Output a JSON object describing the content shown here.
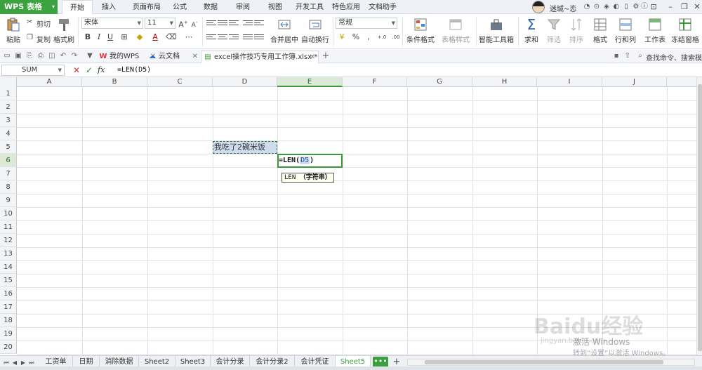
{
  "app": {
    "logo": "WPS 表格",
    "logo_arrow": "▾"
  },
  "menu_tabs": [
    {
      "label": "开始",
      "active": true
    },
    {
      "label": "插入"
    },
    {
      "label": "页面布局"
    },
    {
      "label": "公式"
    },
    {
      "label": "数据"
    },
    {
      "label": "审阅"
    },
    {
      "label": "视图"
    },
    {
      "label": "开发工具"
    },
    {
      "label": "特色应用"
    },
    {
      "label": "文档助手"
    }
  ],
  "user": {
    "name": "迷城~恋"
  },
  "ribbon": {
    "paste": "粘贴",
    "cut": "剪切",
    "copy": "复制",
    "format_painter": "格式刷",
    "font_name": "宋体",
    "font_size": "11",
    "bold": "B",
    "italic": "I",
    "underline": "U",
    "merge_center": "合并居中",
    "wrap_text": "自动换行",
    "number_format": "常规",
    "percent": "%",
    "thousands": ",",
    "decimal_plus": "+.0",
    "decimal_minus": ".00",
    "conditional_format": "条件格式",
    "table_style": "表格样式",
    "smart_toolbox": "智能工具箱",
    "sum": "求和",
    "filter": "筛选",
    "sort": "排序",
    "format": "格式",
    "rows_cols": "行和列",
    "worksheet": "工作表",
    "freeze": "冻结窗格"
  },
  "doc_tabs": [
    {
      "label": "我的WPS",
      "icon": "W"
    },
    {
      "label": "云文档",
      "icon": "☁"
    },
    {
      "label": "excel操作技巧专用工作簿.xlsx *",
      "icon": "▤",
      "active": true
    }
  ],
  "search_placeholder": "查找命令、搜索模板",
  "formula_bar": {
    "name_box": "SUM",
    "cancel": "✕",
    "confirm": "✓",
    "fx": "fx",
    "formula": "=LEN(D5)"
  },
  "columns": [
    "A",
    "B",
    "C",
    "D",
    "E",
    "F",
    "G",
    "H",
    "I",
    "J"
  ],
  "active_column": "E",
  "rows": [
    "1",
    "2",
    "3",
    "4",
    "5",
    "6",
    "7",
    "8",
    "9",
    "10",
    "11",
    "12",
    "13",
    "14",
    "15",
    "16",
    "17",
    "18",
    "19",
    "20"
  ],
  "active_row": "6",
  "cells": {
    "D5": "我吃了2碗米饭",
    "E6_prefix": "=LEN(",
    "E6_ref": "D5",
    "E6_suffix": ")"
  },
  "tooltip": {
    "func": "LEN",
    "arg": "（字符串）"
  },
  "sheets": [
    {
      "label": "工资单"
    },
    {
      "label": "日期"
    },
    {
      "label": "消除数据"
    },
    {
      "label": "Sheet2"
    },
    {
      "label": "Sheet3"
    },
    {
      "label": "会计分录"
    },
    {
      "label": "会计分录2"
    },
    {
      "label": "会计凭证"
    },
    {
      "label": "Sheet5",
      "active": true
    }
  ],
  "more_sheets": "•••",
  "add_sheet": "+",
  "watermark": {
    "brand": "Baidu经验",
    "url": "jingyan.baidu.com",
    "activate1": "激活 Windows",
    "activate2": "转到“设置”以激活 Windows。"
  },
  "colors": {
    "accent": "#3aa040",
    "selected_ref": "#cfdcf0",
    "header_bg": "#f3f4f6"
  }
}
